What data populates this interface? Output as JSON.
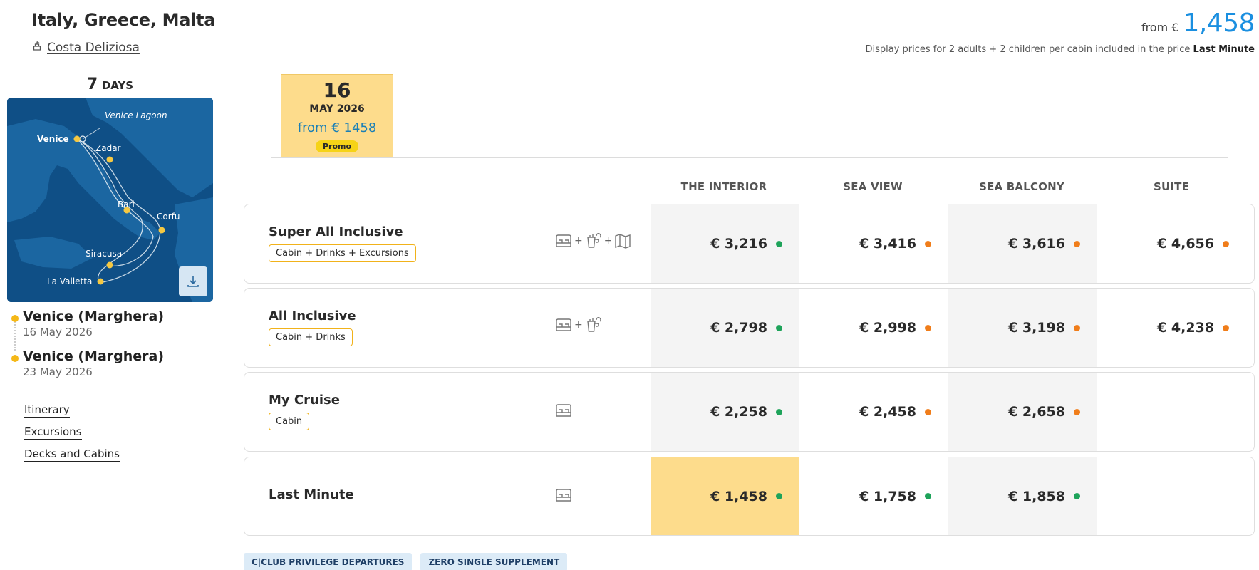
{
  "header": {
    "title": "Italy, Greece, Malta",
    "ship_name": "Costa Deliziosa",
    "price_from_label": "from €",
    "price_from_value": "1,458",
    "disclaimer_text": "Display prices for 2 adults + 2 children per cabin included in the price",
    "disclaimer_bold": "Last Minute"
  },
  "duration": {
    "number": "7",
    "unit": "DAYS"
  },
  "map": {
    "labels": {
      "lagoon": "Venice Lagoon",
      "venice": "Venice",
      "zadar": "Zadar",
      "bari": "Bari",
      "corfu": "Corfu",
      "siracusa": "Siracusa",
      "valletta": "La Valletta"
    },
    "colors": {
      "sea": "#0f4f86",
      "land": "#1d6aa6",
      "route": "#e6eef5",
      "port": "#f5c842"
    }
  },
  "ports": [
    {
      "name": "Venice (Marghera)",
      "date": "16 May 2026"
    },
    {
      "name": "Venice (Marghera)",
      "date": "23 May 2026"
    }
  ],
  "links": [
    "Itinerary",
    "Excursions",
    "Decks and Cabins"
  ],
  "date_tab": {
    "day": "16",
    "month": "MAY 2026",
    "price": "from € 1458",
    "promo": "Promo"
  },
  "columns": [
    "THE INTERIOR",
    "SEA VIEW",
    "SEA BALCONY",
    "SUITE"
  ],
  "packages": [
    {
      "name": "Super All Inclusive",
      "tag": "Cabin + Drinks + Excursions",
      "icons": [
        "bed-icon",
        "drink-icon",
        "map-icon"
      ],
      "prices": [
        {
          "value": "€ 3,216",
          "status": "green"
        },
        {
          "value": "€ 3,416",
          "status": "orange"
        },
        {
          "value": "€ 3,616",
          "status": "orange"
        },
        {
          "value": "€ 4,656",
          "status": "orange"
        }
      ]
    },
    {
      "name": "All Inclusive",
      "tag": "Cabin + Drinks",
      "icons": [
        "bed-icon",
        "drink-icon"
      ],
      "prices": [
        {
          "value": "€ 2,798",
          "status": "green"
        },
        {
          "value": "€ 2,998",
          "status": "orange"
        },
        {
          "value": "€ 3,198",
          "status": "orange"
        },
        {
          "value": "€ 4,238",
          "status": "orange"
        }
      ]
    },
    {
      "name": "My Cruise",
      "tag": "Cabin",
      "icons": [
        "bed-icon"
      ],
      "prices": [
        {
          "value": "€ 2,258",
          "status": "green"
        },
        {
          "value": "€ 2,458",
          "status": "orange"
        },
        {
          "value": "€ 2,658",
          "status": "orange"
        }
      ]
    },
    {
      "name": "Last Minute",
      "tag": "",
      "icons": [
        "bed-icon"
      ],
      "prices": [
        {
          "value": "€ 1,458",
          "status": "green"
        },
        {
          "value": "€ 1,758",
          "status": "green"
        },
        {
          "value": "€ 1,858",
          "status": "green"
        }
      ]
    }
  ],
  "badges": [
    "C|CLUB PRIVILEGE DEPARTURES",
    "ZERO SINGLE SUPPLEMENT"
  ],
  "colors": {
    "accent_blue": "#1a8fe0",
    "highlight": "#fddc8c",
    "tag_border": "#f1b21a",
    "available": "#1ea35a",
    "limited": "#f07d1a"
  }
}
